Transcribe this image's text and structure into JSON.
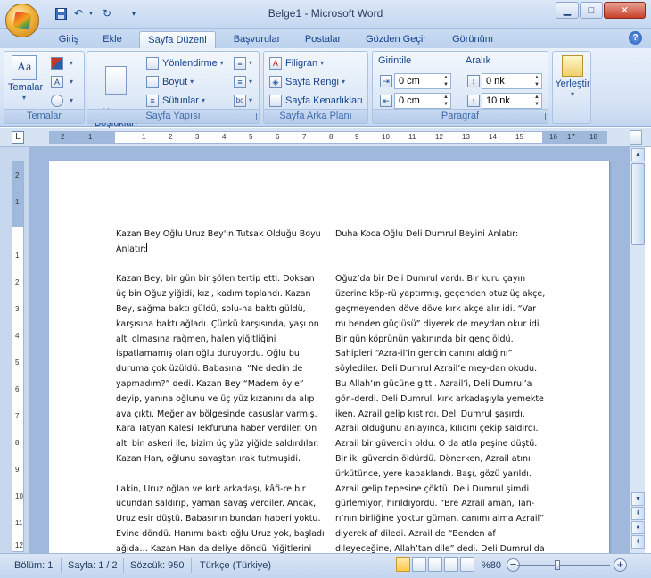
{
  "window": {
    "title": "Belge1 - Microsoft Word"
  },
  "qat": {
    "save_icon": "save-icon",
    "undo_icon": "undo-icon",
    "redo_icon": "redo-icon",
    "customize_icon": "chevron-down-icon"
  },
  "tabs": [
    "Giriş",
    "Ekle",
    "Sayfa Düzeni",
    "Başvurular",
    "Postalar",
    "Gözden Geçir",
    "Görünüm"
  ],
  "active_tab": "Sayfa Düzeni",
  "ribbon": {
    "temalar": {
      "label": "Temalar",
      "group": "Temalar"
    },
    "sayfa_yapisi": {
      "group": "Sayfa Yapısı",
      "kenar": "Kenar\nBoşlukları",
      "yonlendirme": "Yönlendirme",
      "boyut": "Boyut",
      "sutunlar": "Sütunlar"
    },
    "sayfa_arka_plani": {
      "group": "Sayfa Arka Planı",
      "filigran": "Filigran",
      "sayfa_rengi": "Sayfa Rengi",
      "sayfa_kenarliklari": "Sayfa Kenarlıkları"
    },
    "paragraf": {
      "group": "Paragraf",
      "girinti": "Girintile",
      "aralik": "Aralık",
      "left_indent": "0 cm",
      "right_indent": "0 cm",
      "space_before": "0 nk",
      "space_after": "10 nk"
    },
    "yerlestir": {
      "label": "Yerleştir"
    }
  },
  "ruler": {
    "numbers": [
      "2",
      "1",
      "1",
      "2",
      "3",
      "4",
      "5",
      "6",
      "7",
      "8",
      "9",
      "10",
      "11",
      "12",
      "13",
      "14",
      "15",
      "16",
      "17",
      "18"
    ]
  },
  "vruler": {
    "numbers": [
      "2",
      "1",
      "1",
      "2",
      "3",
      "4",
      "5",
      "6",
      "7",
      "8",
      "9",
      "10",
      "11",
      "12",
      "13"
    ]
  },
  "document": {
    "left": {
      "title": "Kazan Bey Oğlu Uruz Bey'in Tutsak Olduğu Boyu Anlatır:",
      "p1": "Kazan Bey, bir gün bir şölen tertip etti. Doksan üç bin Oğuz yiğidi, kızı, kadım toplandı. Kazan Bey, sağma baktı güldü, solu-na baktı güldü, karşısına baktı ağladı. Çünkü karşısında, yaşı on altı olmasına rağmen, halen yiğitliğini ispatlamamış olan oğlu duruyordu.  Oğlu bu duruma çok üzüldü. Babasına, “Ne dedin de yapmadım?” dedi. Kazan Bey “Madem öyle” deyip, yanına oğlunu ve üç yüz kızanını da alıp ava çıktı. Meğer av bölgesinde casuslar varmış. Kara Tatyan Kalesi Tekfuruna haber verdiler. On altı bin askeri ile, bizim üç yüz yiğide saldırdılar. Kazan Han, oğlunu savaştan ırak tutmuşidi.",
      "p2": " Lakin, Uruz oğlan ve kırk arkadaşı, kâfi-re bir ucundan saldırıp, yaman savaş verdiler. Ancak, Uruz esir düştü. Babasının bundan haberi yoktu. Evine döndü. Hanımı baktı oğlu Uruz yok, başladı ağıda… Kazan Han da deliye döndü. Yiğitlerini alıp, hızla av yerine vardı. Baktı ki yaman savaş"
    },
    "right": {
      "title": "Duha Koca Oğlu Deli Dumrul Beyini Anlatır:",
      "p1": "Oğuz’da bir Deli Dumrul vardı. Bir kuru çayın üzerine köp-rü yaptırmış, geçenden otuz üç akçe, geçmeyenden döve döve kırk akçe alır idi. “Var mı benden güçlüsü” diyerek de meydan okur idi. Bir gün köprünün yakınında bir genç öldü. Sahipleri “Azra-il’in gencin canını aldığını” söylediler. Deli Dumrul Azrail’e mey-dan okudu. Bu Allah’ın gücüne gitti. Azrail’i, Deli Dumrul’a gön-derdi. Deli Dumrul, kırk arkadaşıyla yemekte iken, Azrail gelip kıstırdı. Deli Dumrul şaşırdı. Azrail olduğunu anlayınca, kılıcını çekip saldırdı. Azrail bir güvercin oldu. O da atla peşine düştü. Bir iki güvercin öldürdü. Dönerken,  Azrail atını ürkütünce, yere kapaklandı. Başı, gözü yarıldı. Azrail gelip tepesine çöktü. Deli Dumrul şimdi gürlemiyor, hırıldıyordu. “Bre Azrail aman, Tan-rı’nın birliğine yoktur güman, canımı alma Azrail” diyerek af diledi. Azrail de “Benden af dileyeceğine, Allah’tan dile” dedi. Deli Dumrul da"
    }
  },
  "status": {
    "bolum": "Bölüm: 1",
    "sayfa": "Sayfa: 1 / 2",
    "sozcuk": "Sözcük: 950",
    "dil": "Türkçe (Türkiye)",
    "zoom": "%80"
  }
}
